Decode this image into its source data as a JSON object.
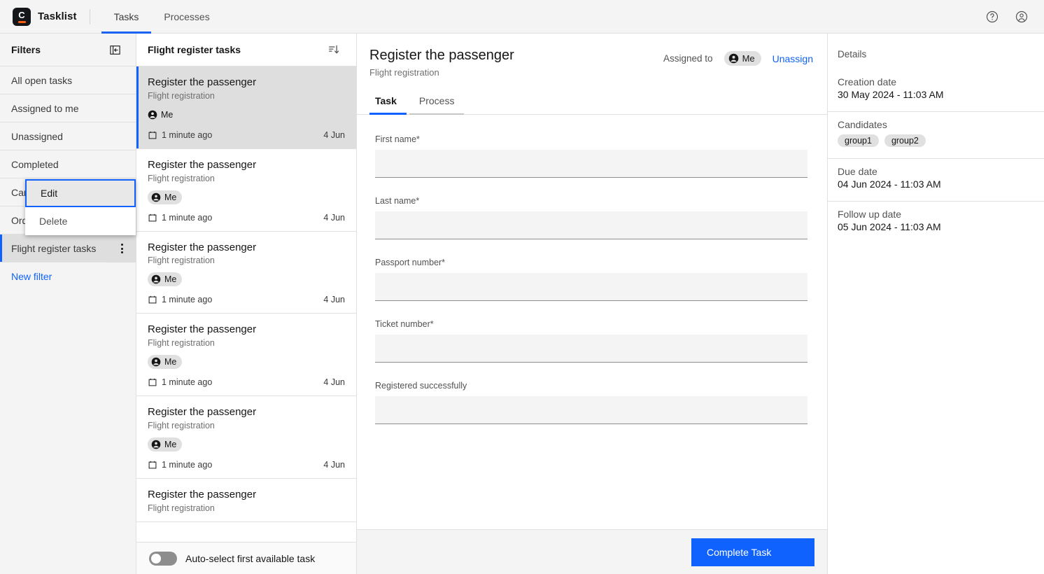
{
  "header": {
    "brand": "Tasklist",
    "logo_letter": "C",
    "nav": [
      {
        "label": "Tasks",
        "active": true
      },
      {
        "label": "Processes",
        "active": false
      }
    ],
    "help_icon": "help-circle-icon",
    "user_icon": "user-avatar-icon"
  },
  "filters": {
    "title": "Filters",
    "collapse_icon": "panel-collapse-icon",
    "items": [
      {
        "label": "All open tasks",
        "selected": false
      },
      {
        "label": "Assigned to me",
        "selected": false
      },
      {
        "label": "Unassigned",
        "selected": false
      },
      {
        "label": "Completed",
        "selected": false
      },
      {
        "label": "Cancelled",
        "selected": false
      },
      {
        "label": "Orders",
        "selected": false
      },
      {
        "label": "Flight register tasks",
        "selected": true
      }
    ],
    "new_filter": "New filter"
  },
  "context_menu": {
    "items": [
      {
        "label": "Edit",
        "focused": true
      },
      {
        "label": "Delete",
        "focused": false
      }
    ]
  },
  "tasklist": {
    "title": "Flight register tasks",
    "sort_icon": "sort-descending-icon",
    "auto_select_label": "Auto-select first available task",
    "auto_select_on": false,
    "tasks": [
      {
        "name": "Register the passenger",
        "process": "Flight registration",
        "assignee": "Me",
        "time": "1 minute ago",
        "due": "4 Jun",
        "selected": true
      },
      {
        "name": "Register the passenger",
        "process": "Flight registration",
        "assignee": "Me",
        "time": "1 minute ago",
        "due": "4 Jun",
        "selected": false
      },
      {
        "name": "Register the passenger",
        "process": "Flight registration",
        "assignee": "Me",
        "time": "1 minute ago",
        "due": "4 Jun",
        "selected": false
      },
      {
        "name": "Register the passenger",
        "process": "Flight registration",
        "assignee": "Me",
        "time": "1 minute ago",
        "due": "4 Jun",
        "selected": false
      },
      {
        "name": "Register the passenger",
        "process": "Flight registration",
        "assignee": "Me",
        "time": "1 minute ago",
        "due": "4 Jun",
        "selected": false
      },
      {
        "name": "Register the passenger",
        "process": "Flight registration",
        "assignee": "",
        "time": "",
        "due": "",
        "selected": false
      }
    ]
  },
  "detail": {
    "title": "Register the passenger",
    "subtitle": "Flight registration",
    "assigned_to_label": "Assigned to",
    "assignee": "Me",
    "unassign_label": "Unassign",
    "tabs": [
      {
        "label": "Task",
        "active": true
      },
      {
        "label": "Process",
        "active": false
      }
    ],
    "fields": [
      {
        "label": "First name*",
        "value": "",
        "placeholder": ""
      },
      {
        "label": "Last name*",
        "value": "",
        "placeholder": ""
      },
      {
        "label": "Passport number*",
        "value": "",
        "placeholder": ""
      },
      {
        "label": "Ticket number*",
        "value": "",
        "placeholder": ""
      },
      {
        "label": "Registered successfully",
        "value": "",
        "placeholder": ""
      }
    ],
    "complete_button": "Complete Task"
  },
  "details_panel": {
    "heading": "Details",
    "creation_date_label": "Creation date",
    "creation_date_value": "30 May 2024 - 11:03 AM",
    "candidates_label": "Candidates",
    "candidates": [
      "group1",
      "group2"
    ],
    "due_date_label": "Due date",
    "due_date_value": "04 Jun 2024 - 11:03 AM",
    "follow_up_label": "Follow up date",
    "follow_up_value": "05 Jun 2024 - 11:03 AM"
  },
  "colors": {
    "accent_blue": "#0f62fe",
    "brand_orange": "#fc5d0d",
    "selected_gray": "#dedede",
    "field_gray": "#f4f4f4"
  }
}
